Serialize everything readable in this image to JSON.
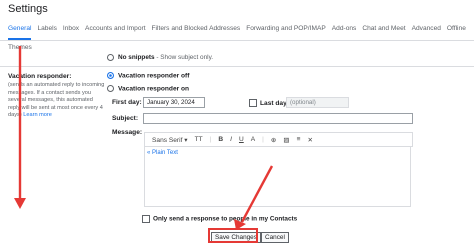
{
  "header": {
    "title": "Settings"
  },
  "tabs": [
    {
      "label": "General",
      "active": true
    },
    {
      "label": "Labels"
    },
    {
      "label": "Inbox"
    },
    {
      "label": "Accounts and Import"
    },
    {
      "label": "Filters and Blocked Addresses"
    },
    {
      "label": "Forwarding and POP/IMAP"
    },
    {
      "label": "Add-ons"
    },
    {
      "label": "Chat and Meet"
    },
    {
      "label": "Advanced"
    },
    {
      "label": "Offline"
    }
  ],
  "tabs_row2": [
    "Themes"
  ],
  "snippets": {
    "label": "No snippets",
    "desc": " - Show subject only."
  },
  "vacation": {
    "title": "Vacation responder:",
    "description": "(sends an automated reply to incoming messages. If a contact sends you several messages, this automated reply will be sent at most once every 4 days)",
    "learn_more": "Learn more",
    "off_label": "Vacation responder off",
    "on_label": "Vacation responder on",
    "first_day_label": "First day:",
    "first_day_value": "January 30, 2024",
    "last_day_label": "Last day:",
    "last_day_placeholder": "(optional)",
    "subject_label": "Subject:",
    "message_label": "Message:",
    "plain_text_link": "« Plain Text",
    "contacts_only_label": "Only send a response to people in my Contacts"
  },
  "toolbar": {
    "font": "Sans Serif",
    "font_caret": "▾",
    "size_icon": "TT",
    "bold": "B",
    "italic": "I",
    "underline": "U",
    "color": "A",
    "link": "⊕",
    "image": "▨",
    "align": "≡",
    "clear": "✕"
  },
  "buttons": {
    "save": "Save Changes",
    "cancel": "Cancel"
  },
  "colors": {
    "accent": "#1a73e8",
    "annotation": "#e53935"
  }
}
